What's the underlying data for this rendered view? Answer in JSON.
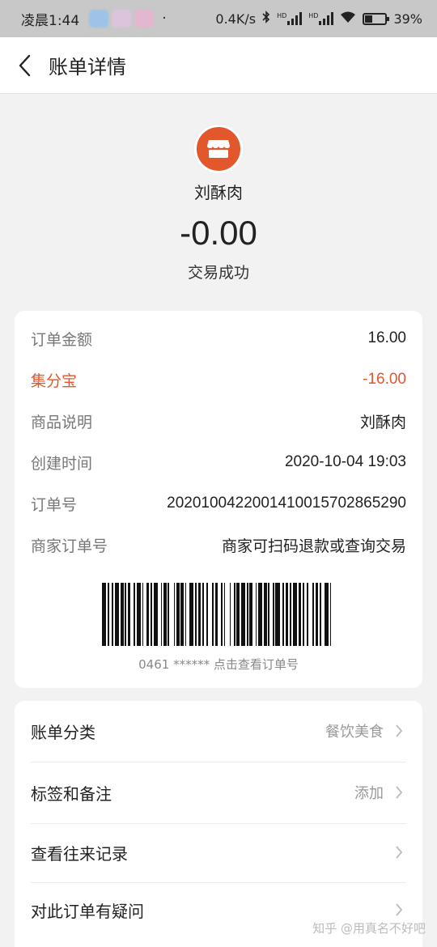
{
  "status_bar": {
    "time": "凌晨1:44",
    "dot": "·",
    "net_speed": "0.4K/s",
    "hd1": "HD",
    "hd2": "HD",
    "battery": "39%",
    "battery_level": 0.39,
    "icons": [
      "bluetooth-icon",
      "signal-icon",
      "wifi-icon",
      "battery-icon"
    ]
  },
  "nav": {
    "title": "账单详情",
    "back_icon": "back-arrow-icon"
  },
  "hero": {
    "merchant_name": "刘酥肉",
    "amount": "-0.00",
    "status": "交易成功",
    "logo_icon": "store-icon",
    "logo_color": "#e2572b"
  },
  "details": [
    {
      "label": "订单金额",
      "value": "16.00"
    },
    {
      "label": "集分宝",
      "value": "-16.00",
      "highlight": true
    },
    {
      "label": "商品说明",
      "value": "刘酥肉"
    },
    {
      "label": "创建时间",
      "value": "2020-10-04 19:03"
    },
    {
      "label": "订单号",
      "value": "2020100422001410015702865290"
    },
    {
      "label": "商家订单号",
      "value": "商家可扫码退款或查询交易"
    }
  ],
  "barcode_caption": "0461 ****** 点击查看订单号",
  "menu": [
    {
      "label": "账单分类",
      "sub": "餐饮美食"
    },
    {
      "label": "标签和备注",
      "sub": "添加"
    },
    {
      "label": "查看往来记录",
      "sub": ""
    },
    {
      "label": "对此订单有疑问",
      "sub": ""
    }
  ],
  "watermark": "知乎 @用真名不好吧",
  "colors": {
    "accent": "#e2572b",
    "background": "#f2f2f2"
  }
}
